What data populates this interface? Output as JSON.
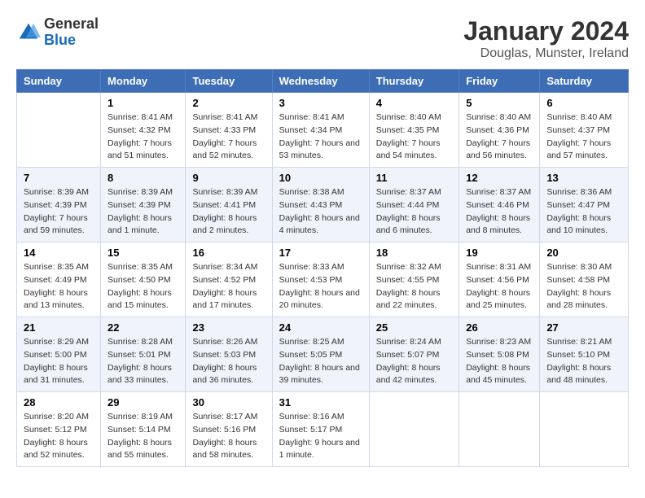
{
  "header": {
    "logo": {
      "general": "General",
      "blue": "Blue"
    },
    "title": "January 2024",
    "subtitle": "Douglas, Munster, Ireland"
  },
  "calendar": {
    "weekdays": [
      "Sunday",
      "Monday",
      "Tuesday",
      "Wednesday",
      "Thursday",
      "Friday",
      "Saturday"
    ],
    "weeks": [
      [
        {
          "day": "",
          "sunrise": "",
          "sunset": "",
          "daylight": ""
        },
        {
          "day": "1",
          "sunrise": "8:41 AM",
          "sunset": "4:32 PM",
          "daylight": "7 hours and 51 minutes."
        },
        {
          "day": "2",
          "sunrise": "8:41 AM",
          "sunset": "4:33 PM",
          "daylight": "7 hours and 52 minutes."
        },
        {
          "day": "3",
          "sunrise": "8:41 AM",
          "sunset": "4:34 PM",
          "daylight": "7 hours and 53 minutes."
        },
        {
          "day": "4",
          "sunrise": "8:40 AM",
          "sunset": "4:35 PM",
          "daylight": "7 hours and 54 minutes."
        },
        {
          "day": "5",
          "sunrise": "8:40 AM",
          "sunset": "4:36 PM",
          "daylight": "7 hours and 56 minutes."
        },
        {
          "day": "6",
          "sunrise": "8:40 AM",
          "sunset": "4:37 PM",
          "daylight": "7 hours and 57 minutes."
        }
      ],
      [
        {
          "day": "7",
          "sunrise": "8:39 AM",
          "sunset": "4:39 PM",
          "daylight": "7 hours and 59 minutes."
        },
        {
          "day": "8",
          "sunrise": "8:39 AM",
          "sunset": "4:39 PM",
          "daylight": "8 hours and 1 minute."
        },
        {
          "day": "9",
          "sunrise": "8:39 AM",
          "sunset": "4:41 PM",
          "daylight": "8 hours and 2 minutes."
        },
        {
          "day": "10",
          "sunrise": "8:38 AM",
          "sunset": "4:43 PM",
          "daylight": "8 hours and 4 minutes."
        },
        {
          "day": "11",
          "sunrise": "8:37 AM",
          "sunset": "4:44 PM",
          "daylight": "8 hours and 6 minutes."
        },
        {
          "day": "12",
          "sunrise": "8:37 AM",
          "sunset": "4:46 PM",
          "daylight": "8 hours and 8 minutes."
        },
        {
          "day": "13",
          "sunrise": "8:36 AM",
          "sunset": "4:47 PM",
          "daylight": "8 hours and 10 minutes."
        }
      ],
      [
        {
          "day": "14",
          "sunrise": "8:35 AM",
          "sunset": "4:49 PM",
          "daylight": "8 hours and 13 minutes."
        },
        {
          "day": "15",
          "sunrise": "8:35 AM",
          "sunset": "4:50 PM",
          "daylight": "8 hours and 15 minutes."
        },
        {
          "day": "16",
          "sunrise": "8:34 AM",
          "sunset": "4:52 PM",
          "daylight": "8 hours and 17 minutes."
        },
        {
          "day": "17",
          "sunrise": "8:33 AM",
          "sunset": "4:53 PM",
          "daylight": "8 hours and 20 minutes."
        },
        {
          "day": "18",
          "sunrise": "8:32 AM",
          "sunset": "4:55 PM",
          "daylight": "8 hours and 22 minutes."
        },
        {
          "day": "19",
          "sunrise": "8:31 AM",
          "sunset": "4:56 PM",
          "daylight": "8 hours and 25 minutes."
        },
        {
          "day": "20",
          "sunrise": "8:30 AM",
          "sunset": "4:58 PM",
          "daylight": "8 hours and 28 minutes."
        }
      ],
      [
        {
          "day": "21",
          "sunrise": "8:29 AM",
          "sunset": "5:00 PM",
          "daylight": "8 hours and 31 minutes."
        },
        {
          "day": "22",
          "sunrise": "8:28 AM",
          "sunset": "5:01 PM",
          "daylight": "8 hours and 33 minutes."
        },
        {
          "day": "23",
          "sunrise": "8:26 AM",
          "sunset": "5:03 PM",
          "daylight": "8 hours and 36 minutes."
        },
        {
          "day": "24",
          "sunrise": "8:25 AM",
          "sunset": "5:05 PM",
          "daylight": "8 hours and 39 minutes."
        },
        {
          "day": "25",
          "sunrise": "8:24 AM",
          "sunset": "5:07 PM",
          "daylight": "8 hours and 42 minutes."
        },
        {
          "day": "26",
          "sunrise": "8:23 AM",
          "sunset": "5:08 PM",
          "daylight": "8 hours and 45 minutes."
        },
        {
          "day": "27",
          "sunrise": "8:21 AM",
          "sunset": "5:10 PM",
          "daylight": "8 hours and 48 minutes."
        }
      ],
      [
        {
          "day": "28",
          "sunrise": "8:20 AM",
          "sunset": "5:12 PM",
          "daylight": "8 hours and 52 minutes."
        },
        {
          "day": "29",
          "sunrise": "8:19 AM",
          "sunset": "5:14 PM",
          "daylight": "8 hours and 55 minutes."
        },
        {
          "day": "30",
          "sunrise": "8:17 AM",
          "sunset": "5:16 PM",
          "daylight": "8 hours and 58 minutes."
        },
        {
          "day": "31",
          "sunrise": "8:16 AM",
          "sunset": "5:17 PM",
          "daylight": "9 hours and 1 minute."
        },
        {
          "day": "",
          "sunrise": "",
          "sunset": "",
          "daylight": ""
        },
        {
          "day": "",
          "sunrise": "",
          "sunset": "",
          "daylight": ""
        },
        {
          "day": "",
          "sunrise": "",
          "sunset": "",
          "daylight": ""
        }
      ]
    ]
  }
}
